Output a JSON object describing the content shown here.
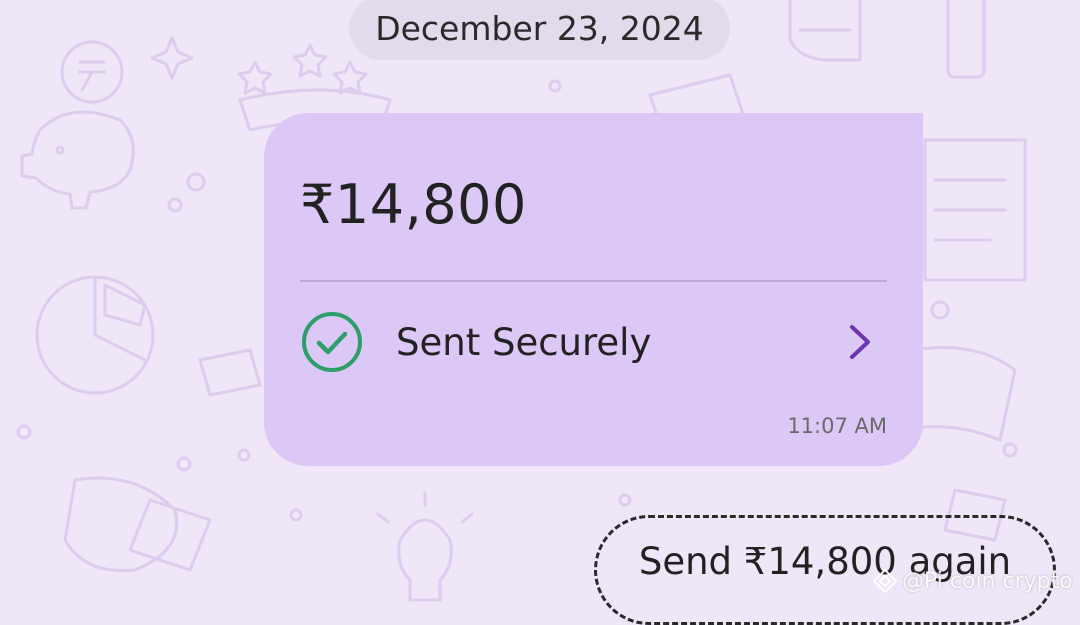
{
  "date_chip": {
    "label": "December 23, 2024"
  },
  "payment": {
    "amount": "₹14,800",
    "status_label": "Sent Securely",
    "status_icon": "check-circle-icon",
    "chevron_icon": "chevron-right-icon",
    "time": "11:07 AM"
  },
  "actions": {
    "send_again_label": "Send ₹14,800 again"
  },
  "watermark": {
    "text": "@Pi coin crypto"
  },
  "colors": {
    "background": "#EFE6F8",
    "card": "#DCC8F6",
    "check_green": "#2E9E6A",
    "chevron_purple": "#6B35B0"
  }
}
